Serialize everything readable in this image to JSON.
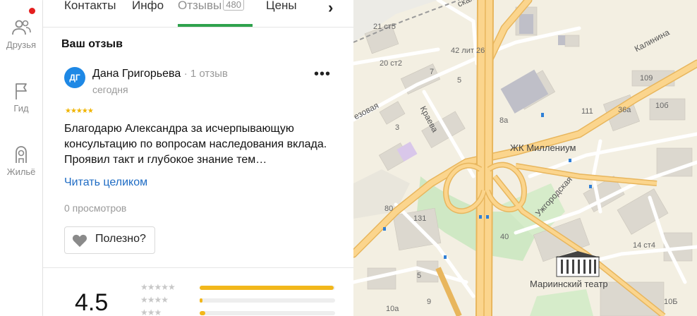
{
  "nav": {
    "items": [
      {
        "label": "Друзья",
        "icon": "friends-icon"
      },
      {
        "label": "Гид",
        "icon": "flag-icon"
      },
      {
        "label": "Жильё",
        "icon": "housing-icon"
      }
    ]
  },
  "tabs": {
    "items": [
      "Контакты",
      "Инфо",
      "Отзывы",
      "Цены"
    ],
    "reviews_count": "480",
    "active": "Отзывы"
  },
  "review": {
    "section_title": "Ваш отзыв",
    "avatar_initials": "ДГ",
    "author": "Дана Григорьева",
    "author_reviews": "1 отзыв",
    "date": "сегодня",
    "stars": "★★★★★",
    "rating_value": 5,
    "text": "Благодарю Александра за исчерпывающую консультацию по вопросам наследования вклада. Проявил такт и глубокое знание тем…",
    "read_more": "Читать целиком",
    "views": "0 просмотров",
    "useful_label": "Полезно?"
  },
  "summary": {
    "rating": "4.5",
    "breakdown": [
      {
        "stars": "★★★★★",
        "fraction": 0.99
      },
      {
        "stars": "★★★★",
        "fraction": 0.02
      },
      {
        "stars": "★★★",
        "fraction": 0.04
      }
    ]
  },
  "map": {
    "labels": {
      "street_kalinina": "Калинина",
      "street_kraeva": "Краева",
      "street_uzhgorodskaya": "Ужгородская",
      "street_ezovaya": "езовая",
      "street_skaya": "ская",
      "jk": "ЖК Миллениум",
      "theatre": "Мариинский театр",
      "h_21c5": "21 ст5",
      "h_42lit26": "42 лит 26",
      "h_20c2": "20 ст2",
      "h_7": "7",
      "h_5": "5",
      "h_3": "3",
      "h_8a": "8а",
      "h_109": "109",
      "h_111": "111",
      "h_36a": "36а",
      "h_10b": "10б",
      "h_80": "80",
      "h_131": "131",
      "h_14c4": "14 ст4",
      "h_10a": "10а",
      "h_10B": "10Б",
      "h_5b": "5",
      "h_9": "9",
      "h_40": "40"
    }
  }
}
